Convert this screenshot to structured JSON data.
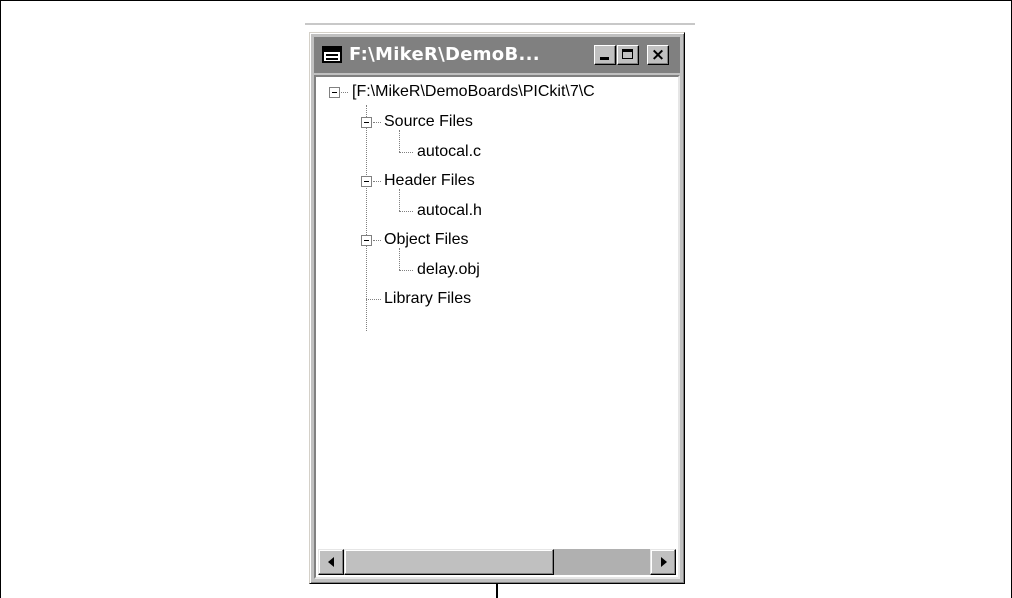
{
  "window": {
    "title": "F:\\MikeR\\DemoB..."
  },
  "tree": {
    "root": {
      "label": "[F:\\MikeR\\DemoBoards\\PICkit\\7\\C"
    },
    "folders": [
      {
        "label": "Source Files",
        "files": [
          "autocal.c"
        ],
        "expanded": true
      },
      {
        "label": "Header Files",
        "files": [
          "autocal.h"
        ],
        "expanded": true
      },
      {
        "label": "Object Files",
        "files": [
          "delay.obj"
        ],
        "expanded": true
      },
      {
        "label": "Library Files",
        "files": [],
        "expanded": false
      }
    ]
  },
  "icons": {
    "system_menu": "window-icon",
    "minimize": "minimize-icon",
    "maximize": "maximize-icon",
    "close": "close-icon",
    "scroll_left": "arrow-left-icon",
    "scroll_right": "arrow-right-icon"
  },
  "colors": {
    "titlebar_inactive": "#808080",
    "window_face": "#c0c0c0",
    "client_background": "#ffffff"
  }
}
